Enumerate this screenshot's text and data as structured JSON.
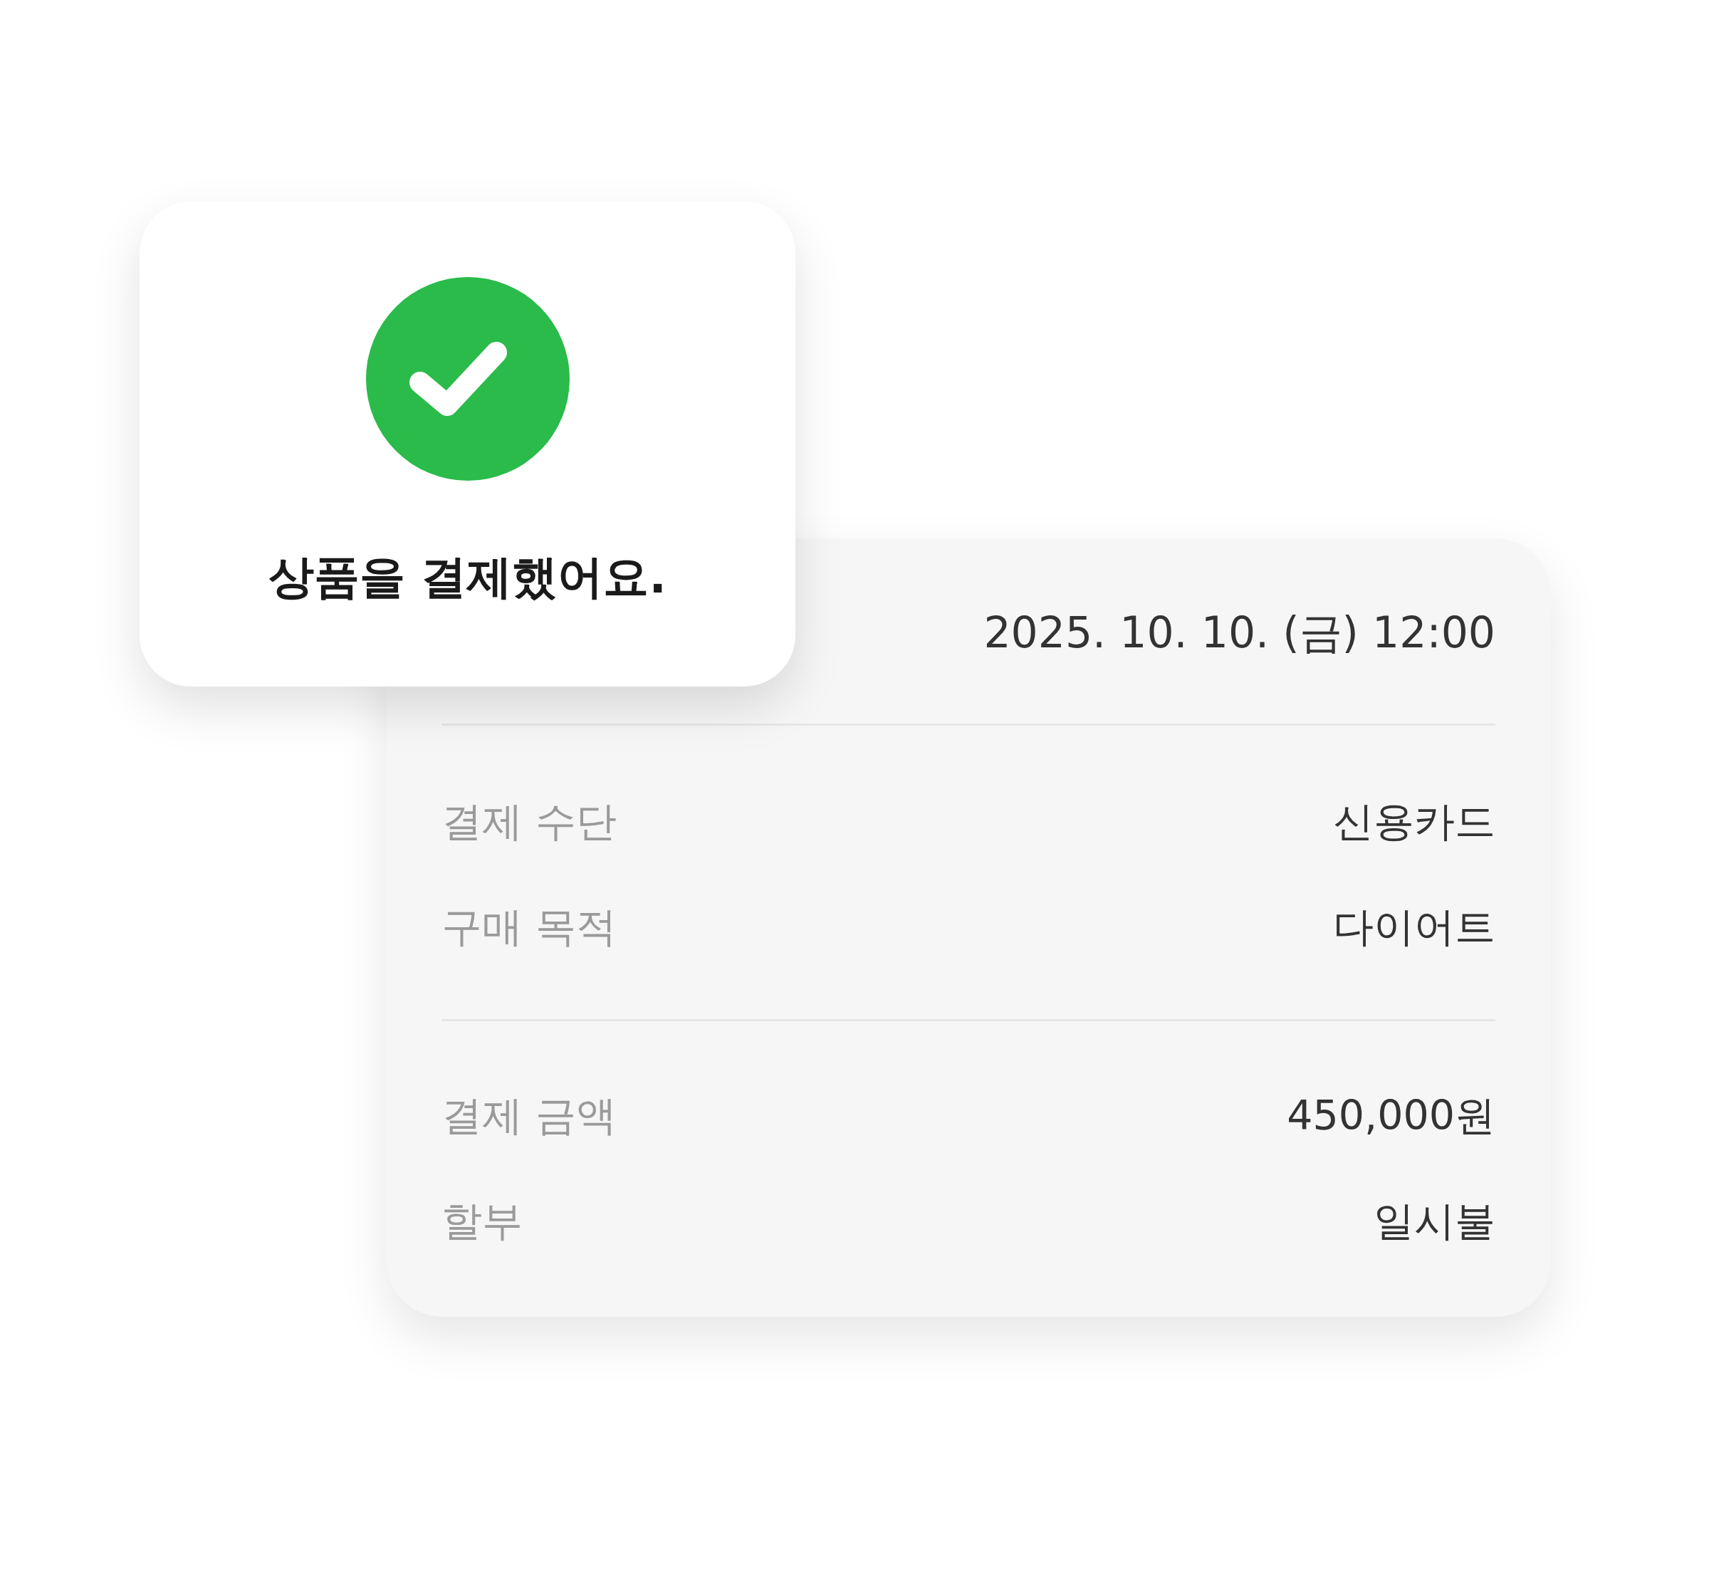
{
  "confirmation": {
    "message": "상품을 결제했어요."
  },
  "receipt": {
    "datetime": "2025. 10. 10. (금) 12:00",
    "groups": [
      {
        "rows": [
          {
            "label": "결제 수단",
            "value": "신용카드"
          },
          {
            "label": "구매 목적",
            "value": "다이어트"
          }
        ]
      },
      {
        "rows": [
          {
            "label": "결제 금액",
            "value": "450,000원"
          },
          {
            "label": "할부",
            "value": "일시불"
          }
        ]
      }
    ]
  }
}
